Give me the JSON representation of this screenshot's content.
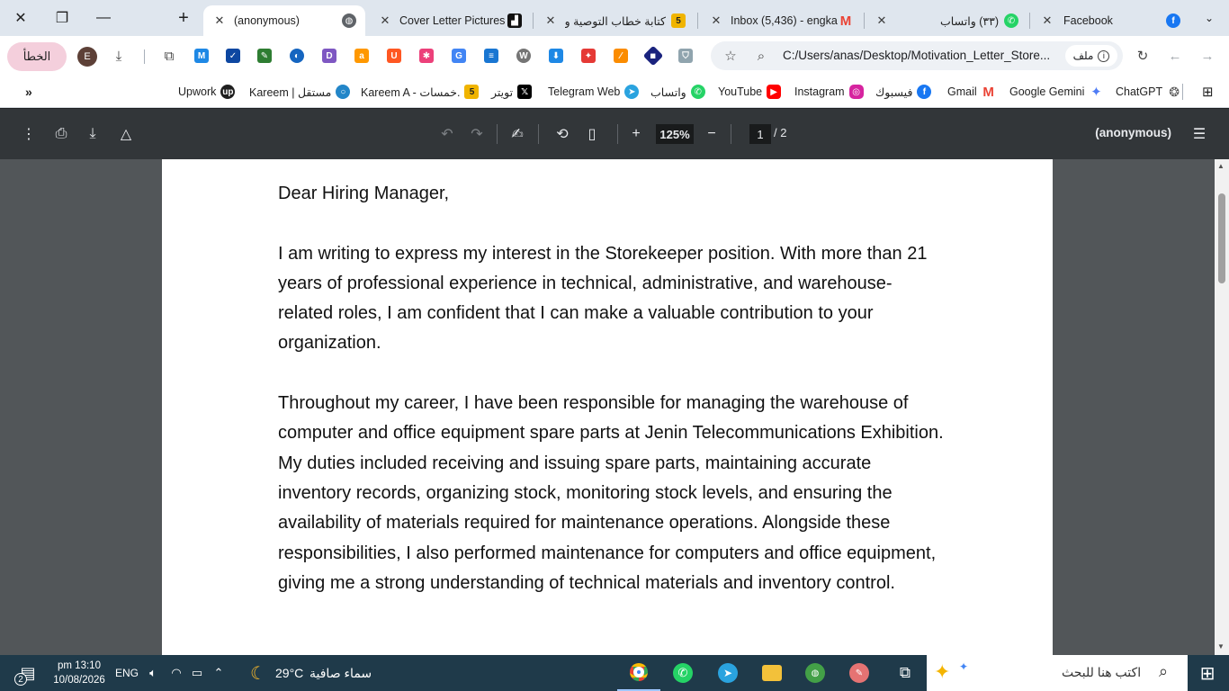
{
  "tabs": [
    {
      "title": "(anonymous)",
      "active": true
    },
    {
      "title": "Cover Letter Pictures"
    },
    {
      "title": "كتابة خطاب التوصية وا",
      "badge": "5"
    },
    {
      "title": "Inbox (5,436) - engka"
    },
    {
      "title": "(٣٣) واتساب"
    },
    {
      "title": "Facebook"
    }
  ],
  "toolbar": {
    "error_label": "الخطأ",
    "profile_initial": "E",
    "url": "C:/Users/anas/Desktop/Motivation_Letter_Store...",
    "site_label": "ملف"
  },
  "bookmarks": [
    {
      "label": "Upwork",
      "icon": "upwork-icon",
      "color": "#1f1f1f"
    },
    {
      "label": "Kareem | مستقل",
      "icon": "mostaql-icon",
      "color": "#2386c8"
    },
    {
      "label": "Kareem A - خمسات.",
      "icon": "khamsat-icon",
      "color": "#f0b400"
    },
    {
      "label": "تويتر",
      "icon": "x-icon",
      "color": "#000000"
    },
    {
      "label": "Telegram Web",
      "icon": "telegram-icon",
      "color": "#2aa3df"
    },
    {
      "label": "واتساب",
      "icon": "whatsapp-icon",
      "color": "#25d366"
    },
    {
      "label": "YouTube",
      "icon": "youtube-icon",
      "color": "#ff0000"
    },
    {
      "label": "Instagram",
      "icon": "instagram-icon",
      "color": "#d6249f"
    },
    {
      "label": "فيسبوك",
      "icon": "facebook-icon",
      "color": "#1877f2"
    },
    {
      "label": "Gmail",
      "icon": "gmail-icon",
      "color": "#ea4335"
    },
    {
      "label": "Google Gemini",
      "icon": "gemini-icon",
      "color": "#4f7cf5"
    },
    {
      "label": "ChatGPT",
      "icon": "chatgpt-icon",
      "color": "#555555"
    }
  ],
  "pdf": {
    "zoom": "125%",
    "page": "1",
    "page_total": "/  2",
    "title": "(anonymous)"
  },
  "letter": {
    "salutation": "Dear Hiring Manager,",
    "p1": "I am writing to express my interest in the Storekeeper position. With more than 21 years of professional experience in technical, administrative, and warehouse-related roles, I am confident that I can make a valuable contribution to your organization.",
    "p2": "Throughout my career, I have been responsible for managing the warehouse of computer and office equipment spare parts at Jenin Telecommunications Exhibition. My duties included receiving and issuing spare parts, maintaining accurate inventory records, organizing stock, monitoring stock levels, and ensuring the availability of materials required for maintenance operations. Alongside these responsibilities, I also performed maintenance for computers and office equipment, giving me a strong understanding of technical materials and inventory control."
  },
  "taskbar": {
    "search_placeholder": "اكتب هنا للبحث",
    "weather_temp": "29°C",
    "weather_desc": "سماء صافية",
    "language": "ENG",
    "time": "pm 13:10",
    "date": "10/08/2026",
    "notification_count": "2"
  },
  "colors": {
    "tab_strip": "#dfe6ee",
    "pdf_toolbar": "#323639",
    "viewer_bg": "#525659",
    "taskbar": "#1f3a4a",
    "error_chip": "#f4cfdc"
  }
}
